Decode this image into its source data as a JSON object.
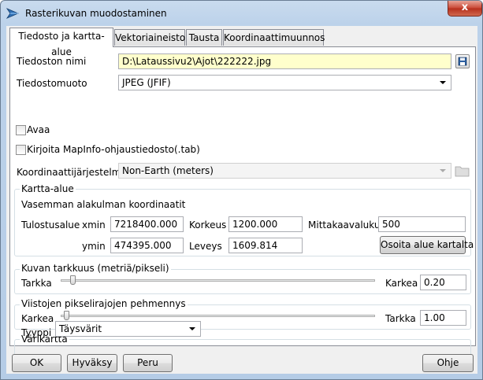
{
  "window": {
    "title": "Rasterikuvan muodostaminen",
    "close_glyph": "x"
  },
  "tabs": [
    {
      "label": "Tiedosto ja kartta-alue",
      "active": true
    },
    {
      "label": "Vektoriaineisto",
      "active": false
    },
    {
      "label": "Tausta",
      "active": false
    },
    {
      "label": "Koordinaattimuunnos",
      "active": false
    }
  ],
  "file": {
    "name_label": "Tiedoston nimi",
    "name_value": "D:\\Lataussivu2\\Ajot\\222222.jpg",
    "format_label": "Tiedostomuoto",
    "format_value": "JPEG (JFIF)"
  },
  "checkboxes": {
    "open_label": "Avaa",
    "open_checked": false,
    "mapinfo_label": "Kirjoita MapInfo-ohjaustiedosto(.tab)",
    "mapinfo_checked": false
  },
  "coord_system": {
    "label": "Koordinaattijärjestelmä",
    "value": "Non-Earth (meters)"
  },
  "map_area": {
    "title": "Kartta-alue",
    "subtitle": "Vasemman alakulman koordinaatit",
    "output_area_label": "Tulostusalue",
    "xmin_label": "xmin",
    "xmin_value": "7218400.000",
    "ymin_label": "ymin",
    "ymin_value": "474395.000",
    "height_label": "Korkeus",
    "height_value": "1200.000",
    "width_label": "Leveys",
    "width_value": "1609.814",
    "scale_label": "Mittakaavaluku",
    "scale_value": "500",
    "show_area_button": "Osoita alue kartalta"
  },
  "resolution": {
    "title": "Kuvan tarkkuus (metriä/pikseli)",
    "left_label": "Tarkka",
    "right_label": "Karkea",
    "value": "0.20",
    "slider_fraction": 0.02
  },
  "smoothing": {
    "title": "Viistojen pikselirajojen pehmennys",
    "left_label": "Karkea",
    "right_label": "Tarkka",
    "value": "1.00",
    "slider_fraction": 0.0
  },
  "colormap": {
    "title": "Värikartta",
    "type_label": "Tyyppi",
    "type_value": "Täysvärit"
  },
  "buttons": {
    "ok": "OK",
    "apply": "Hyväksy",
    "cancel": "Peru",
    "help": "Ohje"
  },
  "colors": {
    "file_field_bg": "#ffffcc",
    "close_button": "#c94634"
  }
}
